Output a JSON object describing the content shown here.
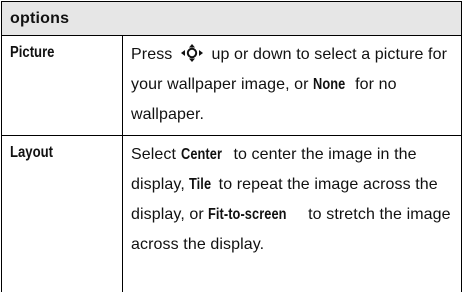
{
  "table": {
    "header": "options",
    "rows": [
      {
        "name": "Picture",
        "desc_parts": {
          "p1": "Press",
          "p2": "up or down to select a picture for your wallpaper image, or",
          "kw1": "None",
          "p3": "for no wallpaper."
        }
      },
      {
        "name": "Layout",
        "desc_parts": {
          "p1": "Select",
          "kw1": "Center",
          "p2": "to center the image in the display,",
          "kw2": "Tile",
          "p3": "to repeat the image across the display, or",
          "kw3": "Fit-to-screen",
          "p4": "to stretch the image across the display."
        }
      }
    ]
  },
  "icons": {
    "nav": "navigation-key-icon"
  }
}
